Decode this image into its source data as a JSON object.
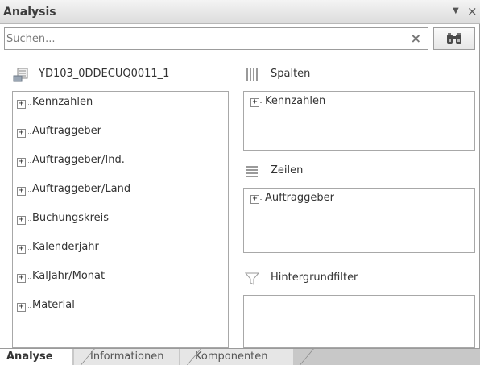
{
  "window": {
    "title": "Analysis",
    "menu_icon": "▼",
    "close_icon": "×"
  },
  "search": {
    "placeholder": "Suchen...",
    "clear_icon": "×"
  },
  "source": {
    "name": "YD103_0DDECUQ0011_1"
  },
  "fields": [
    {
      "label": "Kennzahlen"
    },
    {
      "label": "Auftraggeber"
    },
    {
      "label": "Auftraggeber/Ind."
    },
    {
      "label": "Auftraggeber/Land"
    },
    {
      "label": "Buchungskreis"
    },
    {
      "label": "Kalenderjahr"
    },
    {
      "label": "KalJahr/Monat"
    },
    {
      "label": "Material"
    }
  ],
  "columns": {
    "label": "Spalten",
    "items": [
      {
        "label": "Kennzahlen"
      }
    ]
  },
  "rows": {
    "label": "Zeilen",
    "items": [
      {
        "label": "Auftraggeber"
      }
    ]
  },
  "filter": {
    "label": "Hintergrundfilter"
  },
  "tabs": [
    {
      "label": "Analyse",
      "active": true
    },
    {
      "label": "Informationen",
      "active": false
    },
    {
      "label": "Komponenten",
      "active": false
    }
  ],
  "expander_symbol": "+"
}
